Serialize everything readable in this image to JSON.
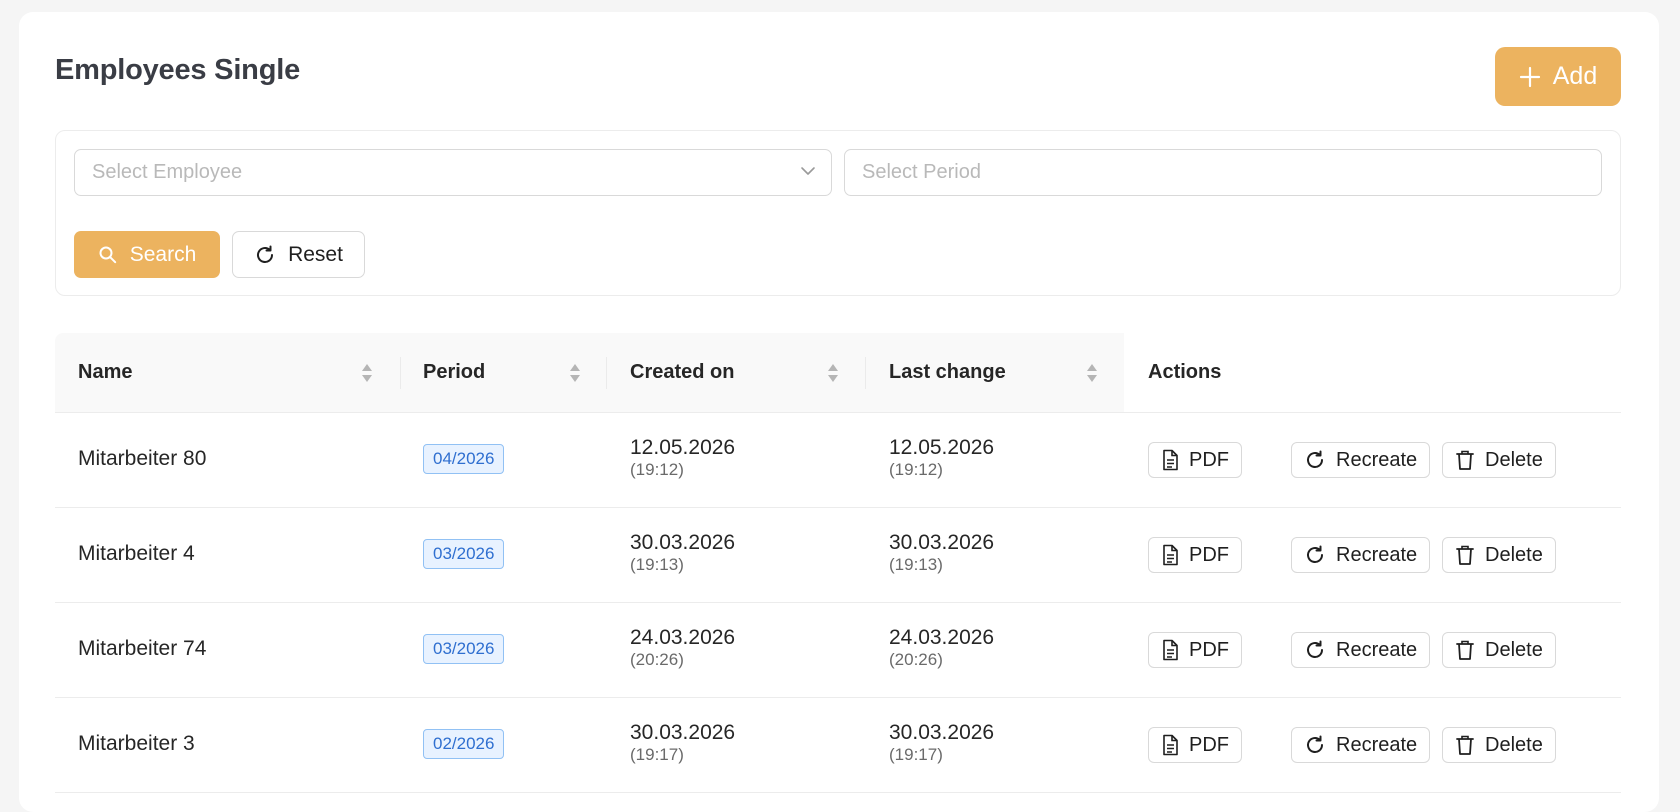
{
  "page": {
    "title": "Employees Single",
    "add_label": "Add"
  },
  "filters": {
    "employee_placeholder": "Select Employee",
    "period_placeholder": "Select Period",
    "search_label": "Search",
    "reset_label": "Reset"
  },
  "table": {
    "columns": {
      "name": "Name",
      "period": "Period",
      "created": "Created on",
      "changed": "Last change",
      "actions": "Actions"
    },
    "action_labels": {
      "pdf": "PDF",
      "recreate": "Recreate",
      "delete": "Delete"
    },
    "rows": [
      {
        "name": "Mitarbeiter 80",
        "period": "04/2026",
        "created_date": "12.05.2026",
        "created_time": "(19:12)",
        "changed_date": "12.05.2026",
        "changed_time": "(19:12)"
      },
      {
        "name": "Mitarbeiter 4",
        "period": "03/2026",
        "created_date": "30.03.2026",
        "created_time": "(19:13)",
        "changed_date": "30.03.2026",
        "changed_time": "(19:13)"
      },
      {
        "name": "Mitarbeiter 74",
        "period": "03/2026",
        "created_date": "24.03.2026",
        "created_time": "(20:26)",
        "changed_date": "24.03.2026",
        "changed_time": "(20:26)"
      },
      {
        "name": "Mitarbeiter 3",
        "period": "02/2026",
        "created_date": "30.03.2026",
        "created_time": "(19:17)",
        "changed_date": "30.03.2026",
        "changed_time": "(19:17)"
      }
    ]
  },
  "colors": {
    "accent": "#ecb35f",
    "tag_bg": "#e8f2ff",
    "tag_text": "#2f6fd0"
  }
}
